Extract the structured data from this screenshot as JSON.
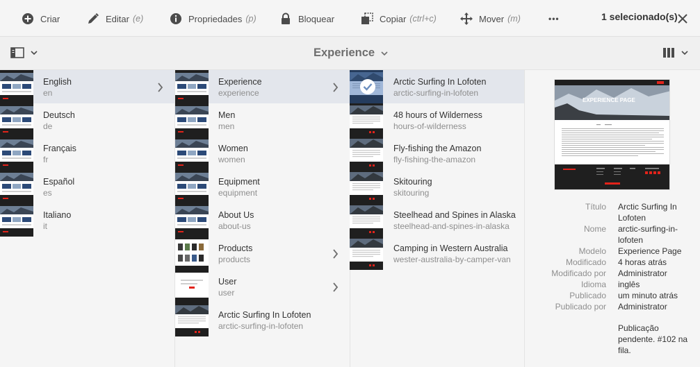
{
  "toolbar": {
    "create_label": "Criar",
    "edit_label": "Editar",
    "edit_shortcut": "(e)",
    "properties_label": "Propriedades",
    "properties_shortcut": "(p)",
    "lock_label": "Bloquear",
    "copy_label": "Copiar",
    "copy_shortcut": "(ctrl+c)",
    "move_label": "Mover",
    "move_shortcut": "(m)",
    "more_label": "•••",
    "selection_count": "1 selecionado(s)"
  },
  "titlebar": {
    "title": "Experience"
  },
  "columns": {
    "languages": [
      {
        "title": "English",
        "name": "en"
      },
      {
        "title": "Deutsch",
        "name": "de"
      },
      {
        "title": "Français",
        "name": "fr"
      },
      {
        "title": "Español",
        "name": "es"
      },
      {
        "title": "Italiano",
        "name": "it"
      }
    ],
    "sections": [
      {
        "title": "Experience",
        "name": "experience"
      },
      {
        "title": "Men",
        "name": "men"
      },
      {
        "title": "Women",
        "name": "women"
      },
      {
        "title": "Equipment",
        "name": "equipment"
      },
      {
        "title": "About Us",
        "name": "about-us"
      },
      {
        "title": "Products",
        "name": "products"
      },
      {
        "title": "User",
        "name": "user"
      },
      {
        "title": "Arctic Surfing In Lofoten",
        "name": "arctic-surfing-in-lofoten"
      }
    ],
    "pages": [
      {
        "title": "Arctic Surfing In Lofoten",
        "name": "arctic-surfing-in-lofoten"
      },
      {
        "title": "48 hours of Wilderness",
        "name": "hours-of-wilderness"
      },
      {
        "title": "Fly-fishing the Amazon",
        "name": "fly-fishing-the-amazon"
      },
      {
        "title": "Skitouring",
        "name": "skitouring"
      },
      {
        "title": "Steelhead and Spines in Alaska",
        "name": "steelhead-and-spines-in-alaska"
      },
      {
        "title": "Camping in Western Australia",
        "name": "wester-australia-by-camper-van"
      }
    ]
  },
  "details": {
    "preview_banner": "EXPERIENCE PAGE",
    "meta": [
      {
        "label": "Título",
        "value": "Arctic Surfing In Lofoten"
      },
      {
        "label": "Nome",
        "value": "arctic-surfing-in-lofoten"
      },
      {
        "label": "Modelo",
        "value": "Experience Page"
      },
      {
        "label": "Modificado",
        "value": "4 horas atrás"
      },
      {
        "label": "Modificado por",
        "value": "Administrator"
      },
      {
        "label": "Idioma",
        "value": "inglês"
      },
      {
        "label": "Publicado",
        "value": "um minuto atrás"
      },
      {
        "label": "Publicado por",
        "value": "Administrator"
      }
    ],
    "status_note": "Publicação pendente. #102 na fila."
  },
  "colors": {
    "accent_red": "#e2231a",
    "selected_row": "#e3e6ec",
    "dark_footer": "#1f1f1f"
  }
}
